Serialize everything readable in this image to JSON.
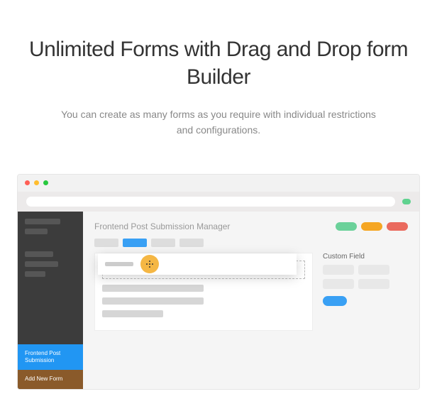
{
  "hero": {
    "title": "Unlimited Forms with Drag and Drop form Builder",
    "subtitle": "You can create as many forms as you require with individual restrictions and configurations."
  },
  "app": {
    "title": "Frontend Post Submission Manager",
    "sidebar": {
      "active_label": "Frontend Post Submission",
      "new_label": "Add New Form"
    },
    "right": {
      "custom_field_label": "Custom Field"
    }
  }
}
